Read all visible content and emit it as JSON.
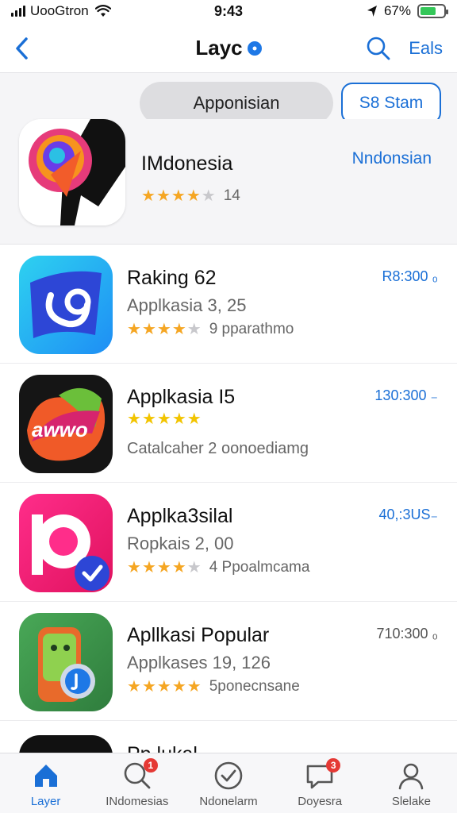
{
  "status_bar": {
    "carrier": "UooGtron",
    "time": "9:43",
    "battery": "67%",
    "battery_level": 0.67
  },
  "nav": {
    "title": "Layc",
    "right_link": "Eals"
  },
  "segment": {
    "pill_label": "Apponisian",
    "outline_label": "S8 Stam"
  },
  "featured": {
    "name": "IMdonesia",
    "link": "Nndonsian",
    "rating": 4,
    "count": "14"
  },
  "apps": [
    {
      "name": "Raking 62",
      "subtitle": "Applkasia 3, 25",
      "rating": 4,
      "rating_text": "9 pparathmo",
      "price": "R8:300 ₀"
    },
    {
      "name": "Applkasia I5",
      "subtitle": "Catalcaher 2 oonoediamg",
      "rating": 5,
      "rating_text": "",
      "price": "130:300 ₋"
    },
    {
      "name": "Applka3silal",
      "subtitle": "Ropkais 2, 00",
      "rating": 4,
      "rating_text": "4 Ppoalmcama",
      "price": "40,:3US₋"
    },
    {
      "name": "Apllkasi Popular",
      "subtitle": "Applkases 19, 126",
      "rating": 5,
      "rating_text": "5ponecnsane",
      "price": "710:300 ₀"
    }
  ],
  "partial_row": {
    "name": "Pp.lukal"
  },
  "tabs": [
    {
      "label": "Layer",
      "icon": "home-icon",
      "badge": ""
    },
    {
      "label": "INdomesias",
      "icon": "search-icon",
      "badge": "1"
    },
    {
      "label": "Ndonelarm",
      "icon": "check-circle-icon",
      "badge": ""
    },
    {
      "label": "Doyesra",
      "icon": "message-icon",
      "badge": "3"
    },
    {
      "label": "Slelake",
      "icon": "person-icon",
      "badge": ""
    }
  ],
  "colors": {
    "accent": "#1a6fd6",
    "star": "#f5a623",
    "badge": "#e53935",
    "battery": "#34c759"
  }
}
